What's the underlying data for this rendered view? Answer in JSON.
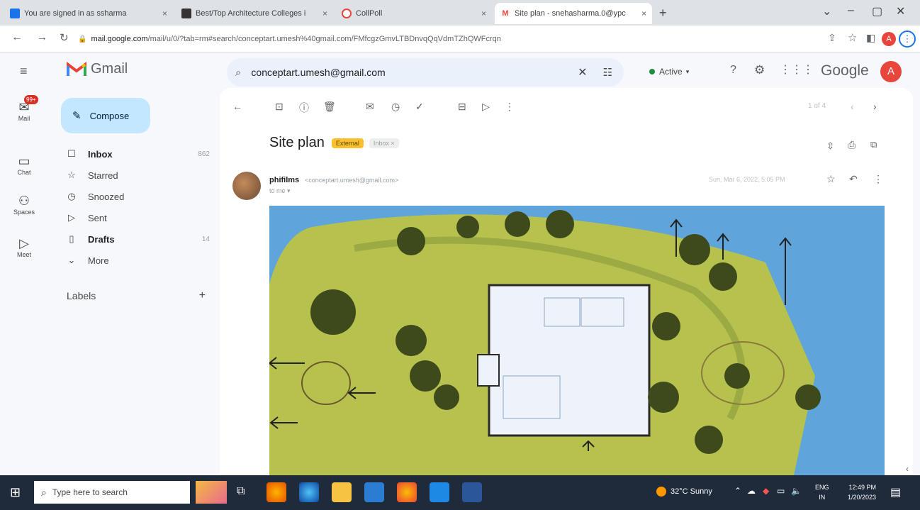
{
  "browser": {
    "tabs": [
      {
        "title": "You are signed in as ssharma",
        "fav_color": "#1a73e8"
      },
      {
        "title": "Best/Top Architecture Colleges i",
        "fav_color": "#333333"
      },
      {
        "title": "CollPoll",
        "fav_color": "#e8453c"
      },
      {
        "title": "Site plan - snehasharma.0@ypc",
        "fav_color": "#ea4335"
      }
    ],
    "new_tab": "+",
    "close": "×",
    "url_domain": "mail.google.com",
    "url_rest": "/mail/u/0/?tab=rm#search/conceptart.umesh%40gmail.com/FMfcgzGmvLTBDnvqQqVdmTZhQWFcrqn",
    "profile_letter": "A"
  },
  "gmail": {
    "brand": "Gmail",
    "search_value": "conceptart.umesh@gmail.com",
    "status": "Active",
    "google": "Google",
    "avatar_letter": "A",
    "rail": [
      {
        "label": "Mail",
        "badge": "99+",
        "icon": "mail-icon"
      },
      {
        "label": "Chat",
        "icon": "chat-icon"
      },
      {
        "label": "Spaces",
        "icon": "spaces-icon"
      },
      {
        "label": "Meet",
        "icon": "meet-icon"
      }
    ],
    "compose": "Compose",
    "nav": [
      {
        "label": "Inbox",
        "count": "862",
        "icon": "inbox-icon",
        "glyph": "☐",
        "bold": true
      },
      {
        "label": "Starred",
        "count": "",
        "icon": "star-icon",
        "glyph": "☆",
        "bold": false
      },
      {
        "label": "Snoozed",
        "count": "",
        "icon": "clock-icon",
        "glyph": "◷",
        "bold": false
      },
      {
        "label": "Sent",
        "count": "",
        "icon": "send-icon",
        "glyph": "▷",
        "bold": false
      },
      {
        "label": "Drafts",
        "count": "14",
        "icon": "draft-icon",
        "glyph": "▯",
        "bold": true
      },
      {
        "label": "More",
        "count": "",
        "icon": "chevron-down-icon",
        "glyph": "⌄",
        "bold": false
      }
    ],
    "labels_heading": "Labels",
    "labels_add": "+"
  },
  "email": {
    "subject": "Site plan",
    "tag_external": "External",
    "tag_inbox": "Inbox ×",
    "pager": "1 of 4",
    "sender_name": "phifilms",
    "sender_email": "<conceptart.umesh@gmail.com>",
    "to": "to me ▾",
    "date": "Sun, Mar 6, 2022, 5:05 PM"
  },
  "taskbar": {
    "search_placeholder": "Type here to search",
    "weather": "32°C Sunny",
    "lang": "ENG",
    "region": "IN",
    "time": "12:49 PM",
    "date": "1/20/2023"
  }
}
